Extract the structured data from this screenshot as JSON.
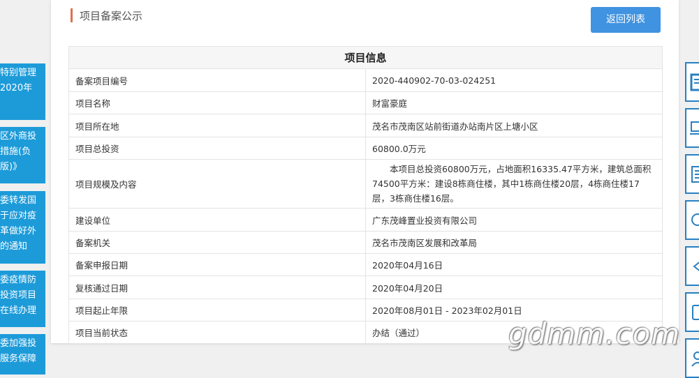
{
  "header": {
    "title": "项目备案公示",
    "back_label": "返回列表"
  },
  "table": {
    "title": "项目信息",
    "rows": [
      {
        "label": "备案项目编号",
        "value": "2020-440902-70-03-024251"
      },
      {
        "label": "项目名称",
        "value": "财富豪庭"
      },
      {
        "label": "项目所在地",
        "value": "茂名市茂南区站前街道办站南片区上塘小区"
      },
      {
        "label": "项目总投资",
        "value": "60800.0万元"
      },
      {
        "label": "项目规模及内容",
        "value": "本项目总投资60800万元，占地面积16335.47平方米，建筑总面积74500平方米：建设8栋商住楼，其中1栋商住楼20层，4栋商住楼17层，3栋商住楼16层。"
      },
      {
        "label": "建设单位",
        "value": "广东茂峰置业投资有限公司"
      },
      {
        "label": "备案机关",
        "value": "茂名市茂南区发展和改革局"
      },
      {
        "label": "备案申报日期",
        "value": "2020年04月16日"
      },
      {
        "label": "复核通过日期",
        "value": "2020年04月20日"
      },
      {
        "label": "项目起止年限",
        "value": "2020年08月01日 - 2023年02月01日"
      },
      {
        "label": "项目当前状态",
        "value": "办结（通过）"
      }
    ]
  },
  "left_tabs": [
    {
      "lines": [
        "特别管理",
        "2020年"
      ]
    },
    {
      "lines": [
        "区外商投",
        "措施(负",
        "版)》"
      ]
    },
    {
      "lines": [
        "委转发国",
        "于应对疫",
        "革做好外",
        "的通知"
      ]
    },
    {
      "lines": [
        "委疫情防",
        "投资项目",
        "在线办理"
      ]
    },
    {
      "lines": [
        "委加强投",
        "服务保障"
      ]
    }
  ],
  "right_icons": [
    "document-icon",
    "computer-icon",
    "list-icon",
    "search-icon",
    "share-icon",
    "phone-icon",
    "user-icon"
  ],
  "watermark": "gdmm.com",
  "colors": {
    "accent": "#3f93e0",
    "title_bar": "#e07050",
    "tab_blue": "#1d9bd9",
    "icon_border": "#2a7fc0"
  }
}
